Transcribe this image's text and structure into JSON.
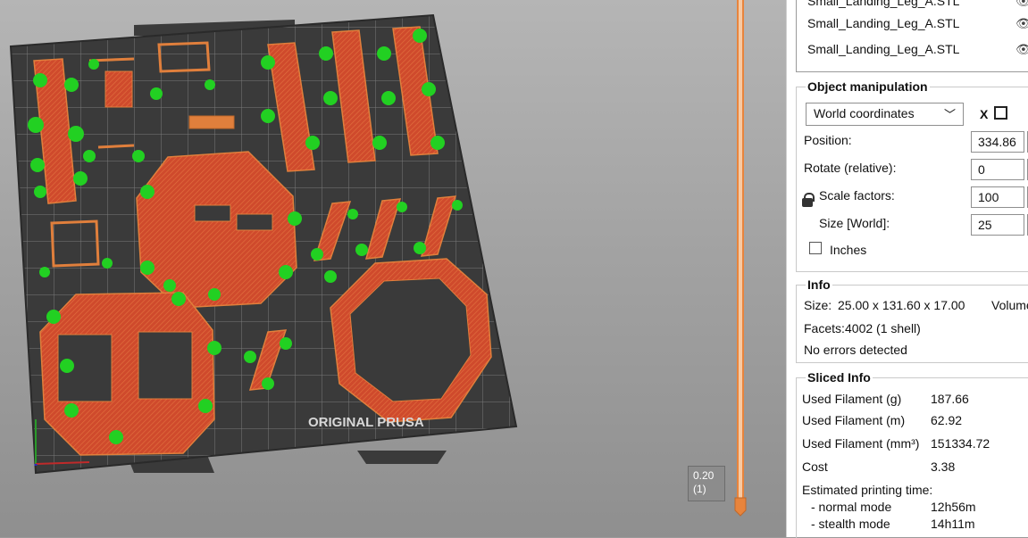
{
  "layer": {
    "height": "0.20",
    "index": "(1)"
  },
  "bed": {
    "brand_text": "ORIGINAL PRUSA"
  },
  "object_list": {
    "items": [
      {
        "name": "Small_Landing_Leg_A.STL"
      },
      {
        "name": "Small_Landing_Leg_A.STL"
      },
      {
        "name": "Small_Landing_Leg_A.STL"
      }
    ]
  },
  "object_manipulation": {
    "title": "Object manipulation",
    "coordinates_select": "World coordinates",
    "axis_header": "X",
    "position_label": "Position:",
    "position_x": "334.86",
    "rotate_label": "Rotate (relative):",
    "rotate_x": "0",
    "scale_label": "Scale factors:",
    "scale_x": "100",
    "size_label": "Size [World]:",
    "size_x": "25",
    "inches_label": "Inches"
  },
  "info": {
    "title": "Info",
    "size_label": "Size:",
    "size_value": "25.00 x 131.60 x 17.00",
    "volume_label": "Volume",
    "facets_label": "Facets:",
    "facets_value": "4002 (1 shell)",
    "errors": "No errors detected"
  },
  "sliced_info": {
    "title": "Sliced Info",
    "rows": [
      {
        "label": "Used Filament (g)",
        "value": "187.66"
      },
      {
        "label": "Used Filament (m)",
        "value": "62.92"
      },
      {
        "label": "Used Filament (mm³)",
        "value": "151334.72"
      },
      {
        "label": "Cost",
        "value": "3.38"
      }
    ],
    "time_label": "Estimated printing time:",
    "normal_label": "- normal mode",
    "normal_value": "12h56m",
    "stealth_label": "- stealth mode",
    "stealth_value": "14h11m"
  },
  "colors": {
    "accent": "#e8843c",
    "part_red": "#d04a2c",
    "support_green": "#22d022",
    "bed_dark": "#353535"
  }
}
